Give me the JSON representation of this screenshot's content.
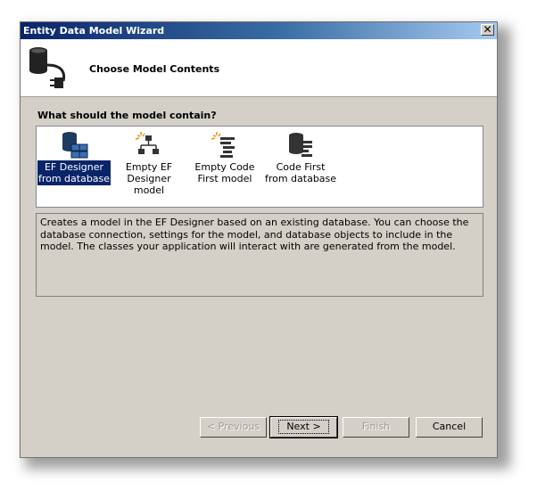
{
  "window": {
    "title": "Entity Data Model Wizard",
    "close_label": "✕"
  },
  "header": {
    "title": "Choose Model Contents"
  },
  "main": {
    "question": "What should the model contain?",
    "model_options": [
      {
        "label": "EF Designer from database",
        "icon": "database-tables-icon",
        "selected": true
      },
      {
        "label": "Empty EF Designer model",
        "icon": "hierarchy-spark-icon",
        "selected": false
      },
      {
        "label": "Empty Code First model",
        "icon": "code-first-spark-icon",
        "selected": false
      },
      {
        "label": "Code First from database",
        "icon": "database-code-icon",
        "selected": false
      }
    ],
    "description": "Creates a model in the EF Designer based on an existing database. You can choose the database connection, settings for the model, and database objects to include in the model. The classes your application will interact with are generated from the model."
  },
  "buttons": {
    "previous_label": "< Previous",
    "next_label": "Next >",
    "finish_label": "Finish",
    "cancel_label": "Cancel"
  },
  "colors": {
    "dialog_background": "#d4d0c8",
    "titlebar_start": "#0a246a",
    "titlebar_end": "#a6caf0",
    "selection": "#0a246a"
  }
}
